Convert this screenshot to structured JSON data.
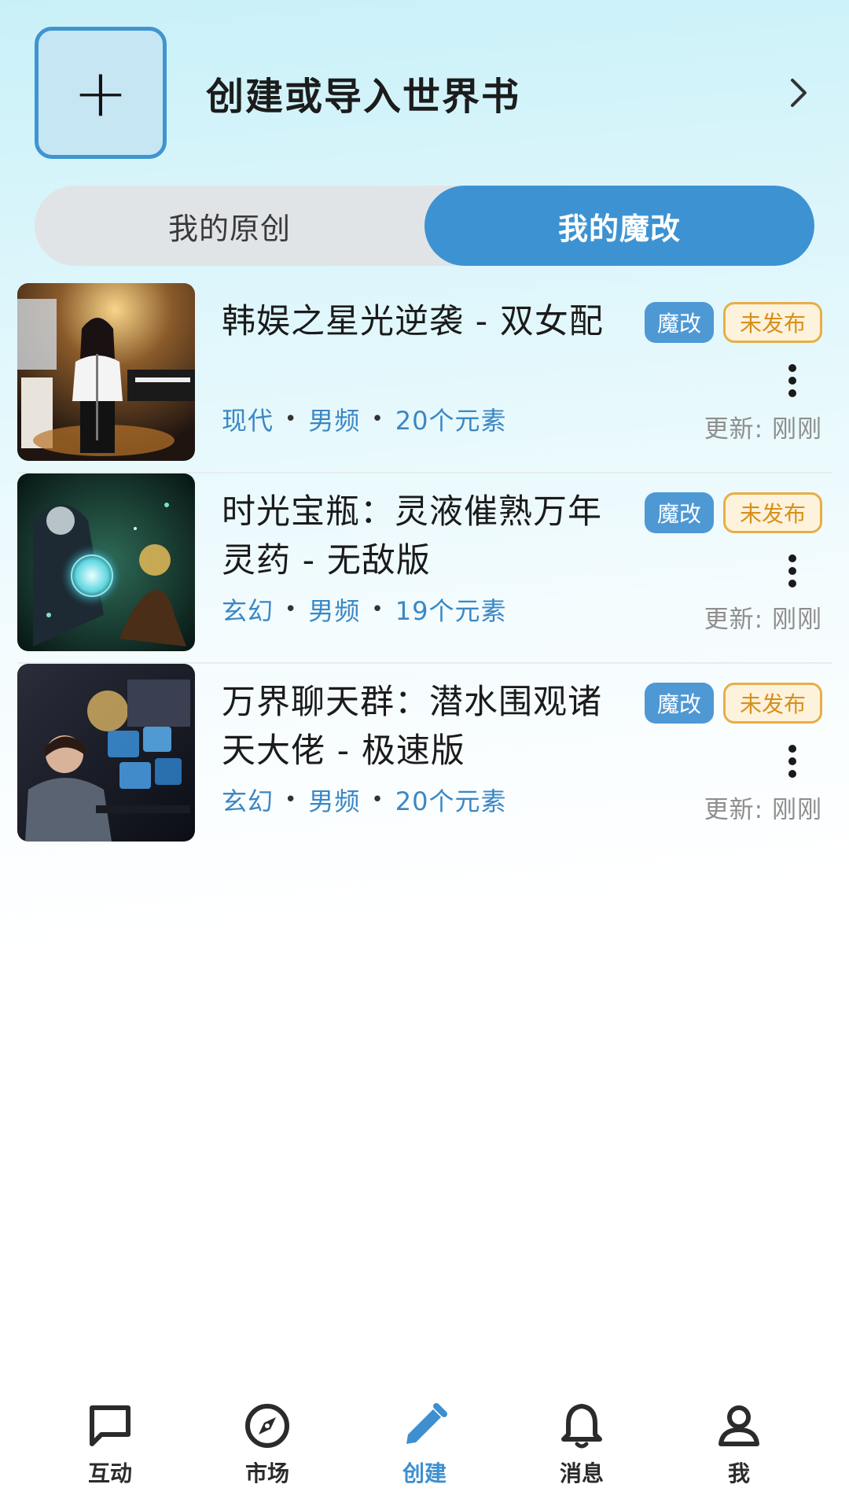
{
  "create": {
    "plus": "+",
    "label": "创建或导入世界书"
  },
  "tabs": [
    {
      "label": "我的原创",
      "active": false
    },
    {
      "label": "我的魔改",
      "active": true
    }
  ],
  "items": [
    {
      "title": "韩娱之星光逆袭 - 双女配",
      "genre": "现代",
      "channel": "男频",
      "count": "20个元素",
      "badge_mod": "魔改",
      "badge_status": "未发布",
      "updated": "更新: 刚刚"
    },
    {
      "title": "时光宝瓶：灵液催熟万年灵药 - 无敌版",
      "genre": "玄幻",
      "channel": "男频",
      "count": "19个元素",
      "badge_mod": "魔改",
      "badge_status": "未发布",
      "updated": "更新: 刚刚"
    },
    {
      "title": "万界聊天群：潜水围观诸天大佬 - 极速版",
      "genre": "玄幻",
      "channel": "男频",
      "count": "20个元素",
      "badge_mod": "魔改",
      "badge_status": "未发布",
      "updated": "更新: 刚刚"
    }
  ],
  "nav": [
    {
      "label": "互动",
      "icon": "chat-icon",
      "active": false
    },
    {
      "label": "市场",
      "icon": "compass-icon",
      "active": false
    },
    {
      "label": "创建",
      "icon": "pencil-icon",
      "active": true
    },
    {
      "label": "消息",
      "icon": "bell-icon",
      "active": false
    },
    {
      "label": "我",
      "icon": "person-icon",
      "active": false
    }
  ],
  "colors": {
    "accent": "#3d93d2",
    "status_border": "#e8ae45",
    "status_text": "#d88f1a"
  }
}
